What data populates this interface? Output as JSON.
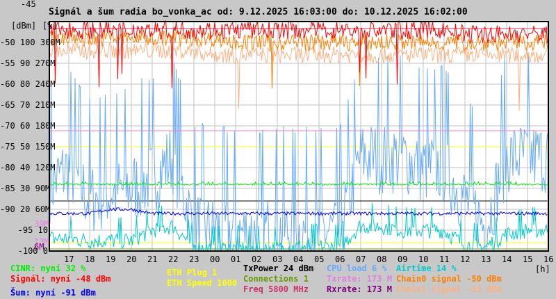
{
  "chart_data": {
    "type": "line",
    "title": "Signál a šum radia bo_vonka_ac od: 9.12.2025 16:03:00 do: 10.12.2025 16:02:00",
    "axis_units": [
      "[dBm]",
      "[%]"
    ],
    "xlabel": "[h]",
    "x_ticks": [
      "17",
      "18",
      "19",
      "20",
      "21",
      "22",
      "23",
      "00",
      "01",
      "02",
      "03",
      "04",
      "05",
      "06",
      "07",
      "08",
      "09",
      "10",
      "11",
      "12",
      "13",
      "14",
      "15",
      "16"
    ],
    "y_ticks_dbm": [
      "-45",
      "-50",
      "-55",
      "-60",
      "-65",
      "-70",
      "-75",
      "-80",
      "-85",
      "-90",
      "-95",
      "-100"
    ],
    "y_ticks_pct": [
      "",
      "100",
      "90",
      "80",
      "70",
      "60",
      "50",
      "40",
      "30",
      "20",
      "10",
      "0"
    ],
    "y_ticks_mbps": [
      "",
      "300M",
      "270M",
      "240M",
      "210M",
      "180M",
      "150M",
      "120M",
      "90M",
      "60M",
      "",
      ""
    ],
    "extra_y_labels": [
      {
        "text": "39M",
        "color": "#e080e0"
      },
      {
        "text": "13M",
        "color": "#e080e0"
      },
      {
        "text": "6M",
        "color": "#800080"
      }
    ],
    "ylim_dbm": [
      -100,
      -45
    ],
    "ylim_pct": [
      0,
      100
    ],
    "ylim_mbps": [
      0,
      330
    ],
    "x_hours_range": [
      "16:03",
      "16:02"
    ],
    "grid": true,
    "series_hourly_from_16h": [
      {
        "name": "Signál",
        "unit": "dBm",
        "color": "#ff0000",
        "jitter": 2.2,
        "values": [
          -47,
          -47,
          -47,
          -47,
          -47,
          -47,
          -47,
          -47,
          -47,
          -47,
          -47,
          -47,
          -47,
          -47,
          -47,
          -47,
          -47,
          -47,
          -47,
          -47,
          -48,
          -48,
          -48,
          -48,
          -48
        ]
      },
      {
        "name": "Chain0 signal",
        "unit": "dBm",
        "color": "#ff8000",
        "jitter": 2,
        "values": [
          -49,
          -49,
          -49,
          -49,
          -49,
          -49,
          -49,
          -49,
          -49,
          -50,
          -50,
          -50,
          -50,
          -50,
          -50,
          -50,
          -50,
          -50,
          -50,
          -50,
          -50,
          -50,
          -50,
          -50,
          -50
        ]
      },
      {
        "name": "Chain1 signal",
        "unit": "dBm",
        "color": "#ffb080",
        "jitter": 2,
        "values": [
          -52,
          -52,
          -52,
          -52,
          -52,
          -52,
          -52,
          -52,
          -53,
          -53,
          -53,
          -53,
          -53,
          -53,
          -53,
          -53,
          -53,
          -53,
          -53,
          -53,
          -53,
          -53,
          -53,
          -53,
          -53
        ]
      },
      {
        "name": "Šum",
        "unit": "dBm",
        "color": "#0000ff",
        "jitter": 0.4,
        "values": [
          -91,
          -91,
          -91,
          -90,
          -90,
          -91,
          -91,
          -91,
          -91,
          -91,
          -91,
          -91,
          -91,
          -91,
          -91,
          -91,
          -91,
          -91,
          -91,
          -91,
          -91,
          -91,
          -91,
          -91,
          -91
        ]
      },
      {
        "name": "CINR",
        "unit": "%",
        "color": "#00ee00",
        "jitter": 0.4,
        "values": [
          32,
          32,
          32,
          32,
          32,
          32,
          32,
          32,
          32,
          32,
          32,
          32,
          32,
          32,
          32,
          32,
          32,
          32,
          32,
          32,
          32,
          32,
          32,
          32,
          32
        ]
      },
      {
        "name": "CPU load",
        "unit": "%",
        "color": "#66aaff",
        "jitter": 18,
        "values": [
          30,
          40,
          25,
          28,
          30,
          35,
          45,
          12,
          10,
          9,
          9,
          10,
          9,
          10,
          9,
          45,
          45,
          45,
          40,
          40,
          25,
          12,
          45,
          45,
          45
        ]
      },
      {
        "name": "Airtime",
        "unit": "%",
        "color": "#00cccc",
        "jitter": 4,
        "values": [
          6,
          6,
          5,
          5,
          5,
          10,
          12,
          2,
          1,
          1,
          1,
          1,
          2,
          2,
          2,
          12,
          12,
          10,
          10,
          10,
          3,
          2,
          8,
          10,
          10
        ]
      },
      {
        "name": "Txrate",
        "unit": "M",
        "color": "#e080e0",
        "jitter": 0,
        "values": [
          173,
          173,
          173,
          173,
          173,
          173,
          173,
          173,
          173,
          173,
          173,
          173,
          173,
          173,
          173,
          173,
          173,
          173,
          173,
          173,
          173,
          173,
          173,
          173,
          173
        ]
      },
      {
        "name": "Rxrate",
        "unit": "M",
        "color": "#800080",
        "jitter": 0,
        "values": [
          173,
          173,
          173,
          173,
          173,
          173,
          173,
          173,
          173,
          173,
          173,
          173,
          173,
          173,
          173,
          173,
          173,
          173,
          173,
          173,
          173,
          173,
          173,
          173,
          173
        ]
      },
      {
        "name": "TxPower",
        "unit": "%",
        "color": "#000000",
        "jitter": 0,
        "values": [
          24,
          24,
          24,
          24,
          24,
          24,
          24,
          24,
          24,
          24,
          24,
          24,
          24,
          24,
          24,
          24,
          24,
          24,
          24,
          24,
          24,
          24,
          24,
          24,
          24
        ]
      },
      {
        "name": "ETH Speed",
        "unit": "%",
        "color": "#ffff00",
        "jitter": 0,
        "values": [
          50,
          50,
          50,
          50,
          50,
          50,
          50,
          50,
          50,
          50,
          50,
          50,
          50,
          50,
          50,
          50,
          50,
          50,
          50,
          50,
          50,
          50,
          50,
          50,
          50
        ]
      },
      {
        "name": "Connections",
        "unit": "%",
        "color": "#669900",
        "jitter": 0,
        "values": [
          1,
          1,
          1,
          1,
          1,
          1,
          1,
          1,
          1,
          1,
          1,
          1,
          1,
          1,
          1,
          1,
          1,
          1,
          1,
          1,
          1,
          1,
          1,
          1,
          1
        ]
      }
    ]
  },
  "legend": [
    {
      "text": "CINR: nyní 32 %",
      "color": "#00ee00"
    },
    {
      "text": "Signál: nyní -48 dBm",
      "color": "#ff0000"
    },
    {
      "text": "Šum: nyní -91 dBm",
      "color": "#0000ff"
    },
    {
      "text": "ETH Plug 1",
      "color": "#ffff00"
    },
    {
      "text": "ETH Speed 1000",
      "color": "#ffff00"
    },
    {
      "text": "TxPower 24 dBm",
      "color": "#000000"
    },
    {
      "text": "Connections 1",
      "color": "#669900"
    },
    {
      "text": "Freq 5800 MHz",
      "color": "#cc3366"
    },
    {
      "text": "CPU load 6 %",
      "color": "#66aaff"
    },
    {
      "text": "Txrate: 173 M",
      "color": "#e080e0"
    },
    {
      "text": "Rxrate: 173 M",
      "color": "#800080"
    },
    {
      "text": "Airtime 14 %",
      "color": "#00cccc"
    },
    {
      "text": "Chain0 signal -50 dBm",
      "color": "#ff8000"
    },
    {
      "text": "Chain1 signal -53 dBm",
      "color": "#ffb080"
    }
  ]
}
